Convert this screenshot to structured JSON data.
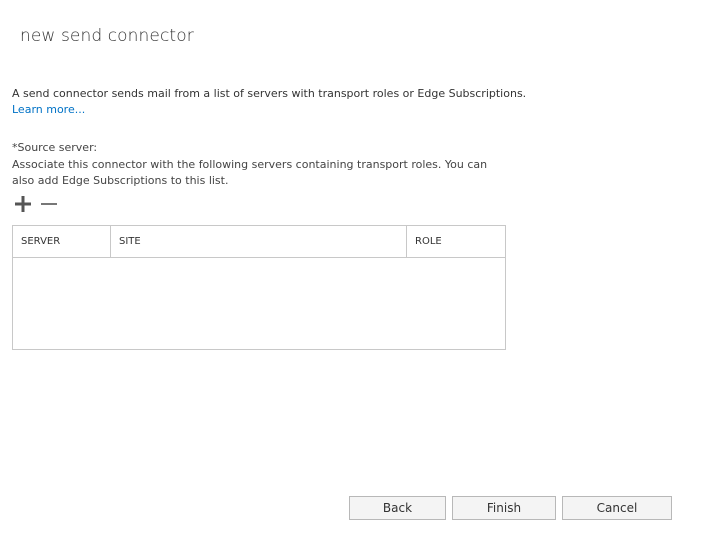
{
  "dialog": {
    "title": "new send connector"
  },
  "intro": {
    "text": "A send connector sends mail from a list of servers with transport roles or Edge Subscriptions.",
    "link": "Learn more..."
  },
  "source": {
    "label": "*Source server:",
    "description": "Associate this connector with the following servers containing transport roles. You can also add Edge Subscriptions to this list."
  },
  "toolbar": {
    "add_icon": "plus-icon",
    "remove_icon": "minus-icon"
  },
  "table": {
    "columns": [
      "SERVER",
      "SITE",
      "ROLE"
    ],
    "rows": []
  },
  "buttons": {
    "back": "Back",
    "finish": "Finish",
    "cancel": "Cancel"
  },
  "colors": {
    "link": "#0072c6",
    "icon": "#555555",
    "border": "#c8c8c8"
  }
}
